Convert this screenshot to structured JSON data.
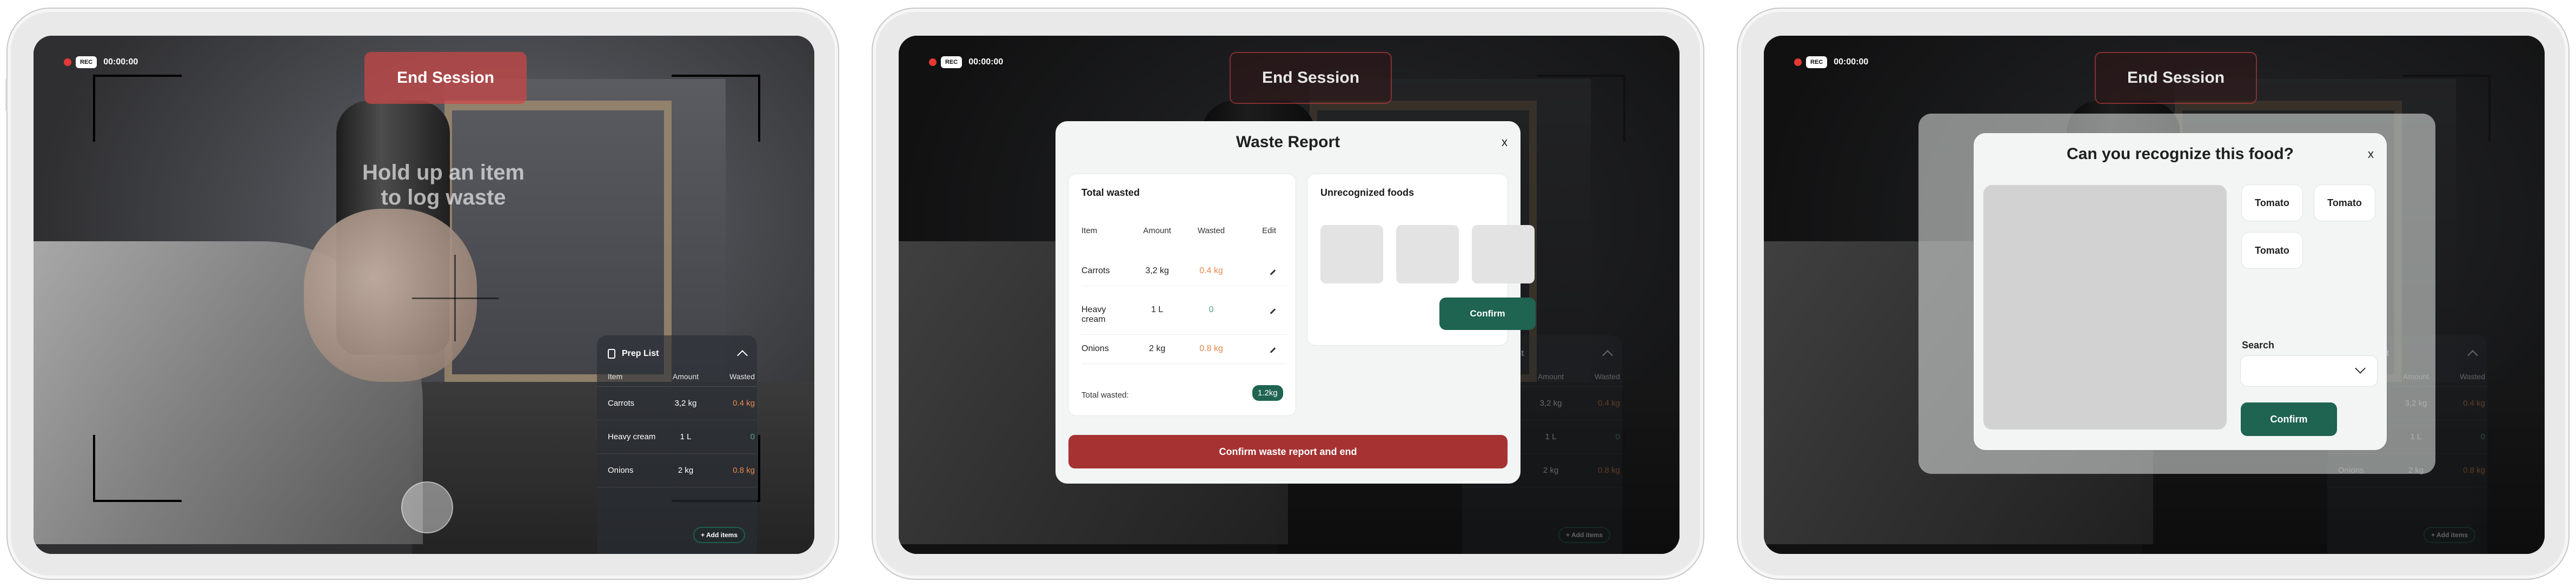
{
  "recording": {
    "badge": "REC",
    "time": "00:00:00"
  },
  "end_session_label": "End Session",
  "camera_hint": "Hold up an item to log waste",
  "prep_list": {
    "title": "Prep List",
    "columns": [
      "Item",
      "Amount",
      "Wasted"
    ],
    "rows": [
      {
        "item": "Carrots",
        "amount": "3,2 kg",
        "wasted": "0.4 kg"
      },
      {
        "item": "Heavy cream",
        "amount": "1 L",
        "wasted": "0"
      },
      {
        "item": "Onions",
        "amount": "2 kg",
        "wasted": "0.8 kg"
      }
    ],
    "add_label": "+ Add items"
  },
  "waste_report": {
    "title": "Waste Report",
    "close": "x",
    "total_wasted_title": "Total wasted",
    "columns": [
      "Item",
      "Amount",
      "Wasted",
      "Edit"
    ],
    "rows": [
      {
        "item": "Carrots",
        "amount": "3,2 kg",
        "wasted": "0.4 kg"
      },
      {
        "item": "Heavy cream",
        "amount": "1 L",
        "wasted": "0"
      },
      {
        "item": "Onions",
        "amount": "2 kg",
        "wasted": "0.8 kg"
      }
    ],
    "total_label": "Total wasted:",
    "total_value": "1.2kg",
    "unrecognized_title": "Unrecognized foods",
    "confirm_label": "Confirm",
    "confirm_end_label": "Confirm waste report and end"
  },
  "recognize": {
    "title": "Can you recognize this food?",
    "close": "x",
    "suggestions": [
      "Tomato",
      "Tomato",
      "Tomato"
    ],
    "search_label": "Search",
    "confirm_label": "Confirm"
  },
  "colors": {
    "accent_green": "#1e6450",
    "danger_red": "#a63232",
    "waste_orange": "#e6884d"
  }
}
